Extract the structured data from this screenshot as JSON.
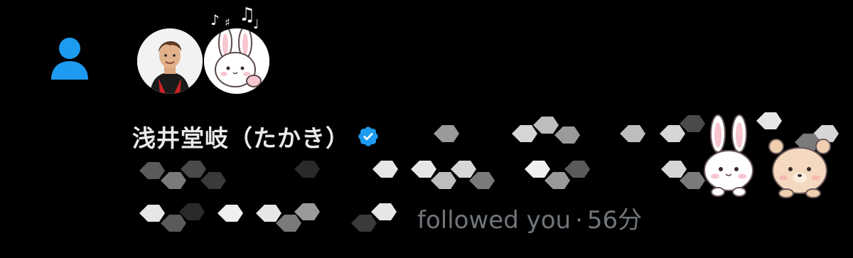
{
  "notification": {
    "type_icon": "person-icon",
    "accent_color": "#1d9bf0",
    "user": {
      "display_name": "浅井堂岐（たかき）",
      "verified": true,
      "verified_icon": "verified-badge-icon"
    },
    "action": "followed you",
    "separator": "·",
    "time_ago": "56分"
  },
  "decorations": {
    "music_notes": [
      "♪",
      "♯",
      "♫",
      "♩"
    ],
    "sticker_icons": [
      "bunny-sticker-icon",
      "bear-sticker-icon"
    ]
  }
}
